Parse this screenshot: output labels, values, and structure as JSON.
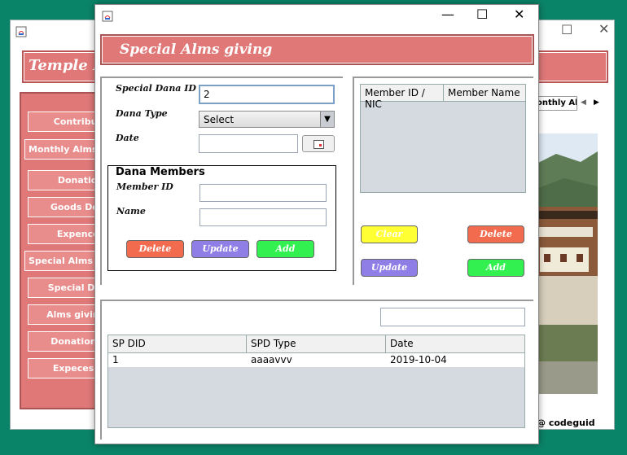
{
  "background_window": {
    "banner_title": "Temple M",
    "sidebar": [
      {
        "label": "Contributo"
      },
      {
        "label": "Monthly Alms"
      },
      {
        "label": "Donation"
      },
      {
        "label": "Goods Dona"
      },
      {
        "label": "Expences"
      },
      {
        "label": "Special Alms g"
      },
      {
        "label": "Special Dona"
      },
      {
        "label": "Alms giving T"
      },
      {
        "label": "Donation Ty"
      },
      {
        "label": "Expecess T"
      }
    ],
    "tab_label": "onthly Alm",
    "footer_text": "@ codeguid"
  },
  "window": {
    "title": "Special Alms giving",
    "controls": {
      "minimize": "—",
      "maximize": "☐",
      "close": "✕"
    }
  },
  "form": {
    "special_dana_id_label": "Special Dana ID",
    "special_dana_id_value": "2",
    "dana_type_label": "Dana Type",
    "dana_type_selected": "Select",
    "date_label": "Date",
    "date_value": ""
  },
  "dana_members": {
    "title": "Dana Members",
    "member_id_label": "Member ID",
    "member_id_value": "",
    "name_label": "Name",
    "name_value": "",
    "delete_label": "Delete",
    "update_label": "Update",
    "add_label": "Add"
  },
  "members_table": {
    "columns": [
      "Member ID / NIC",
      "Member Name"
    ]
  },
  "right_buttons": {
    "clear_label": "Clear",
    "delete_label": "Delete",
    "update_label": "Update",
    "add_label": "Add"
  },
  "search": {
    "value": ""
  },
  "records_table": {
    "columns": [
      "SP DID",
      "SPD Type",
      "Date"
    ],
    "rows": [
      {
        "id": "1",
        "type": "aaaavvv",
        "date": "2019-10-04"
      }
    ]
  },
  "colors": {
    "banner": "#e07878",
    "delete": "#f26b4e",
    "update": "#8f7ee6",
    "add": "#33f051",
    "clear": "#ffff33"
  }
}
